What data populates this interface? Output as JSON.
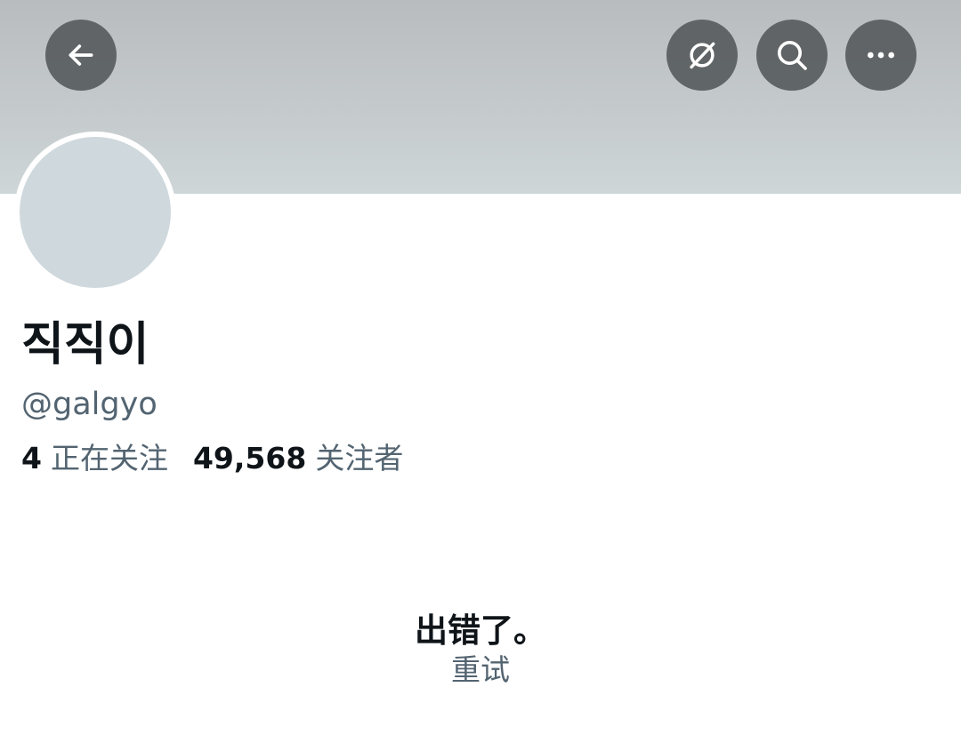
{
  "header": {
    "buttons": [
      {
        "name": "back",
        "icon": "arrow-left-icon"
      },
      {
        "name": "grok",
        "icon": "grok-icon"
      },
      {
        "name": "search",
        "icon": "search-icon"
      },
      {
        "name": "more",
        "icon": "more-horizontal-icon"
      }
    ]
  },
  "profile": {
    "display_name": "직직이",
    "handle": "@galgyo",
    "following_count": "4",
    "following_label": "正在关注",
    "followers_count": "49,568",
    "followers_label": "关注者"
  },
  "error": {
    "title": "出错了。",
    "retry_label": "重试"
  },
  "colors": {
    "primary_text": "#0f1419",
    "secondary_text": "#536471",
    "avatar_placeholder": "#cfd8dc",
    "header_button_bg": "#585c5e"
  }
}
